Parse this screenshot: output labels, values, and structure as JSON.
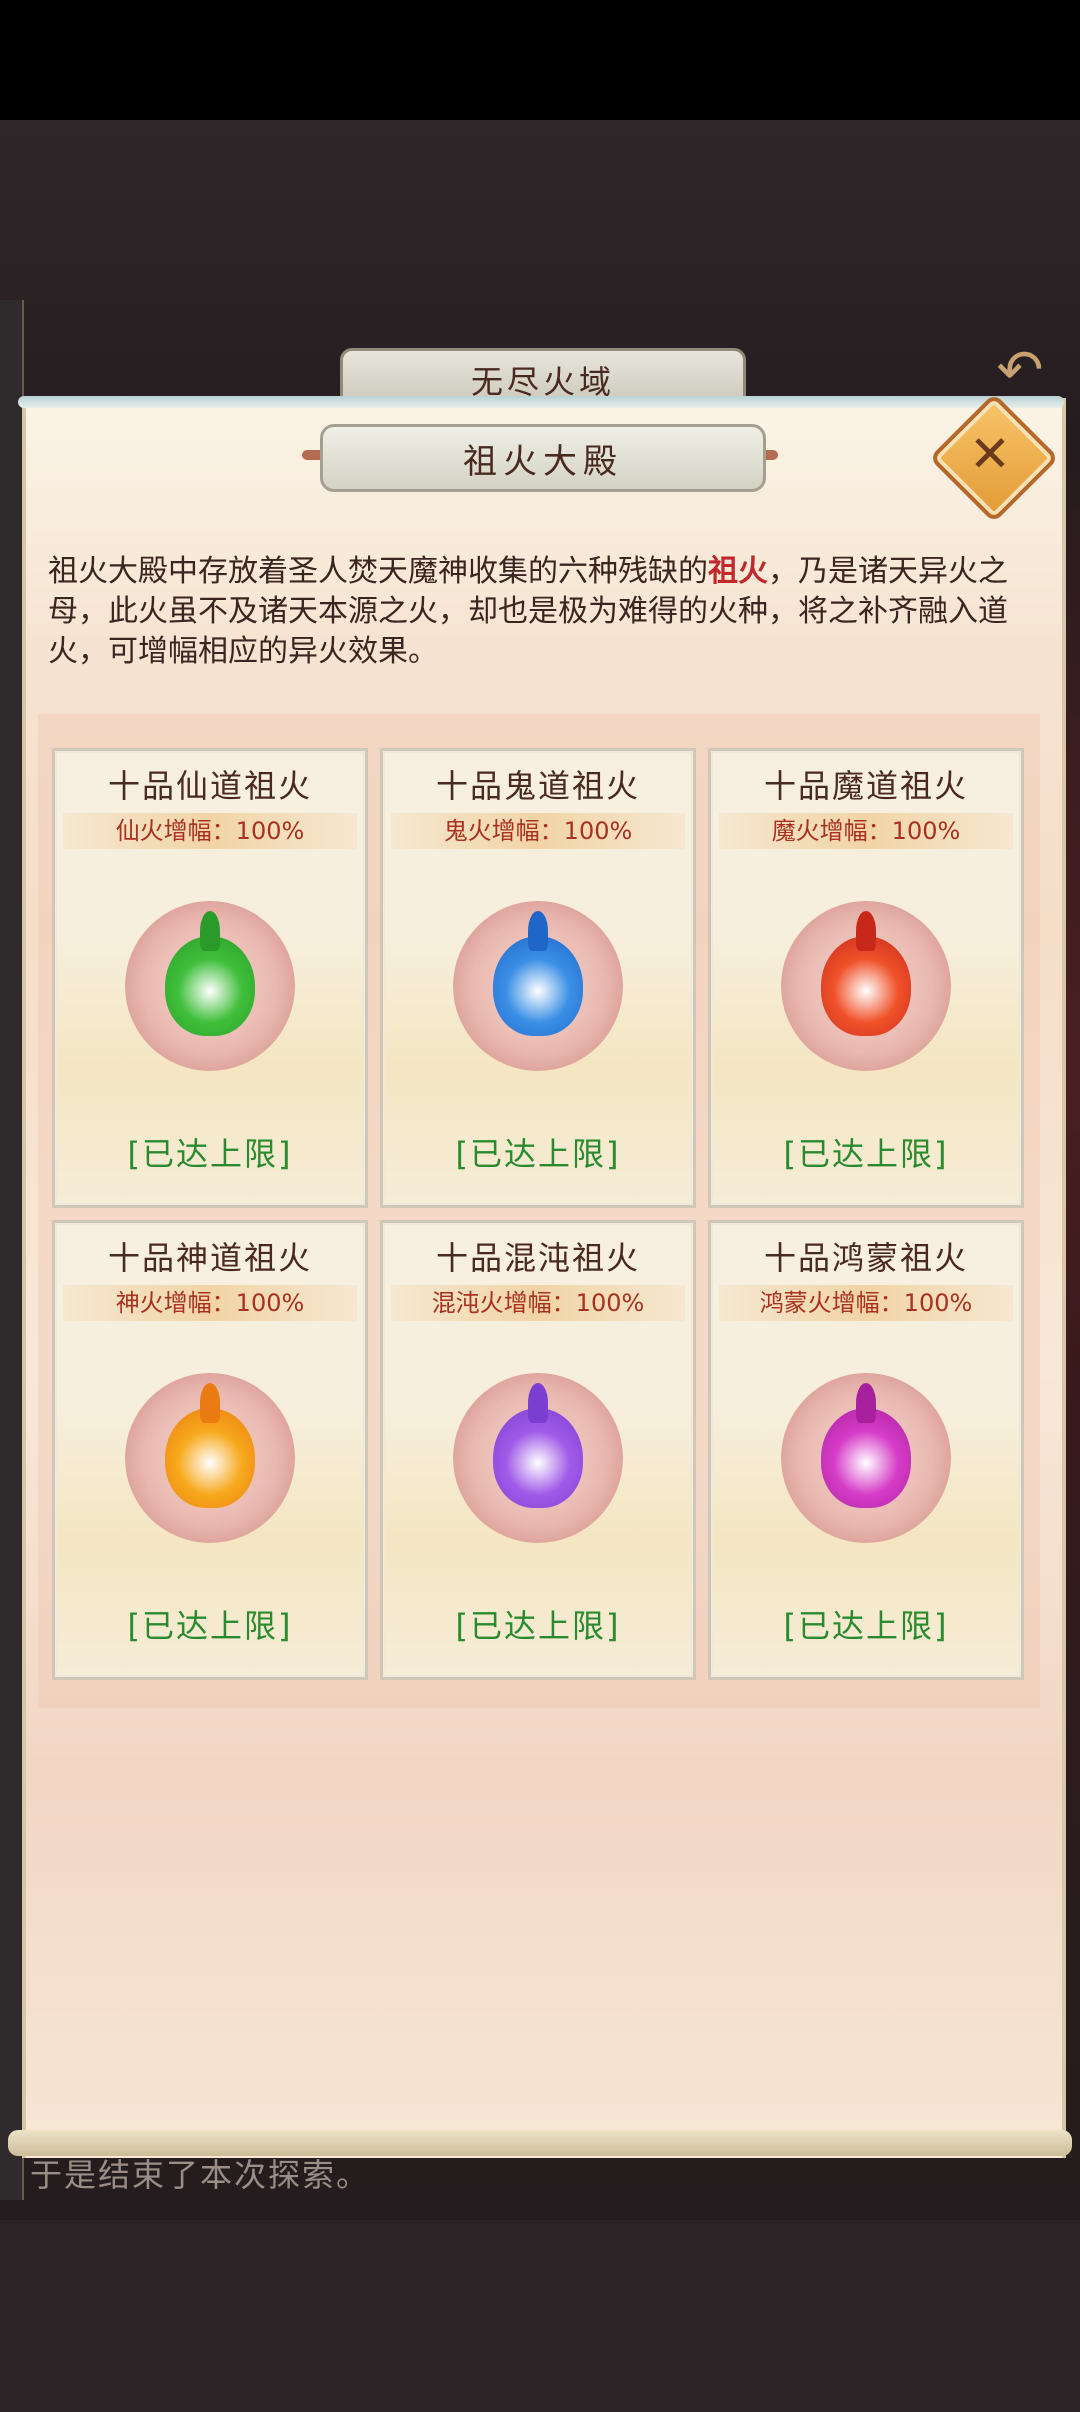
{
  "outer": {
    "title": "无尽火域",
    "back_icon": "back-arrow-icon",
    "log_text": "于是结束了本次探索。"
  },
  "panel": {
    "title": "祖火大殿",
    "close_icon": "close-icon",
    "description_before": "祖火大殿中存放着圣人焚天魔神收集的六种残缺的",
    "description_highlight": "祖火",
    "description_after": "，乃是诸天异火之母，此火虽不及诸天本源之火，却也是极为难得的火种，将之补齐融入道火，可增幅相应的异火效果。"
  },
  "cards": [
    {
      "name": "十品仙道祖火",
      "boost": "仙火增幅：100%",
      "status": "[已达上限]",
      "color": "#3fbf3a",
      "flame": "#2a9b2a"
    },
    {
      "name": "十品鬼道祖火",
      "boost": "鬼火增幅：100%",
      "status": "[已达上限]",
      "color": "#3a8fe6",
      "flame": "#1f66c8"
    },
    {
      "name": "十品魔道祖火",
      "boost": "魔火增幅：100%",
      "status": "[已达上限]",
      "color": "#f0522a",
      "flame": "#c8281a"
    },
    {
      "name": "十品神道祖火",
      "boost": "神火增幅：100%",
      "status": "[已达上限]",
      "color": "#f7a91c",
      "flame": "#ea7a12"
    },
    {
      "name": "十品混沌祖火",
      "boost": "混沌火增幅：100%",
      "status": "[已达上限]",
      "color": "#a05ae8",
      "flame": "#7a3ed0"
    },
    {
      "name": "十品鸿蒙祖火",
      "boost": "鸿蒙火增幅：100%",
      "status": "[已达上限]",
      "color": "#d63cc8",
      "flame": "#a8209e"
    }
  ]
}
